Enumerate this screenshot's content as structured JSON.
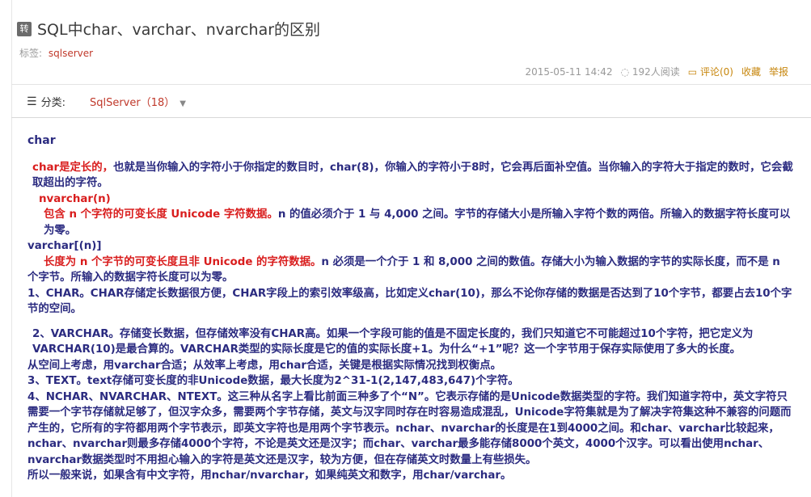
{
  "post": {
    "badge": "转",
    "title": "SQL中char、varchar、nvarchar的区别",
    "tags_label": "标签:",
    "tag": "sqlserver",
    "date": "2015-05-11 14:42",
    "reads": "192人阅读",
    "comments": "评论(0)",
    "favorite": "收藏",
    "report": "举报"
  },
  "category": {
    "label": "分类:",
    "value": "SqlServer（18）"
  },
  "content": {
    "heading_char": "char",
    "p1_red": "char是定长的，",
    "p1_rest": "也就是当你输入的字符小于你指定的数目时，char(8)，你输入的字符小于8时，它会再后面补空值。当你输入的字符大于指定的数时，它会截取超出的字符。",
    "heading_nvarchar": "nvarchar(n)",
    "p2_red": "包含 n 个字符的可变长度 Unicode 字符数据。",
    "p2_rest": "n 的值必须介于 1 与 4,000 之间。字节的存储大小是所输入字符个数的两倍。所输入的数据字符长度可以为零。",
    "heading_varchar": "varchar[(n)]",
    "p3_red": "长度为 n 个字节的可变长度且非 Unicode 的字符数据。",
    "p3_rest": "n 必须是一个介于 1 和 8,000 之间的数值。存储大小为输入数据的字节的实际长度，而不是 n 个字节。所输入的数据字符长度可以为零。",
    "p4": "1、CHAR。CHAR存储定长数据很方便，CHAR字段上的索引效率级高，比如定义char(10)，那么不论你存储的数据是否达到了10个字节，都要占去10个字节的空间。",
    "p5": "2、VARCHAR。存储变长数据，但存储效率没有CHAR高。如果一个字段可能的值是不固定长度的，我们只知道它不可能超过10个字符，把它定义为 VARCHAR(10)是最合算的。VARCHAR类型的实际长度是它的值的实际长度+1。为什么“+1”呢？这一个字节用于保存实际使用了多大的长度。",
    "p6": "从空间上考虑，用varchar合适；从效率上考虑，用char合适，关键是根据实际情况找到权衡点。",
    "p7": "3、TEXT。text存储可变长度的非Unicode数据，最大长度为2^31-1(2,147,483,647)个字符。",
    "p8": "4、NCHAR、NVARCHAR、NTEXT。这三种从名字上看比前面三种多了个“N”。它表示存储的是Unicode数据类型的字符。我们知道字符中，英文字符只需要一个字节存储就足够了，但汉字众多，需要两个字节存储，英文与汉字同时存在时容易造成混乱，Unicode字符集就是为了解决字符集这种不兼容的问题而产生的，它所有的字符都用两个字节表示，即英文字符也是用两个字节表示。nchar、nvarchar的长度是在1到4000之间。和char、varchar比较起来，nchar、nvarchar则最多存储4000个字符，不论是英文还是汉字；而char、varchar最多能存储8000个英文，4000个汉字。可以看出使用nchar、nvarchar数据类型时不用担心输入的字符是英文还是汉字，较为方便，但在存储英文时数量上有些损失。",
    "p9": "所以一般来说，如果含有中文字符，用nchar/nvarchar，如果纯英文和数字，用char/varchar。"
  }
}
